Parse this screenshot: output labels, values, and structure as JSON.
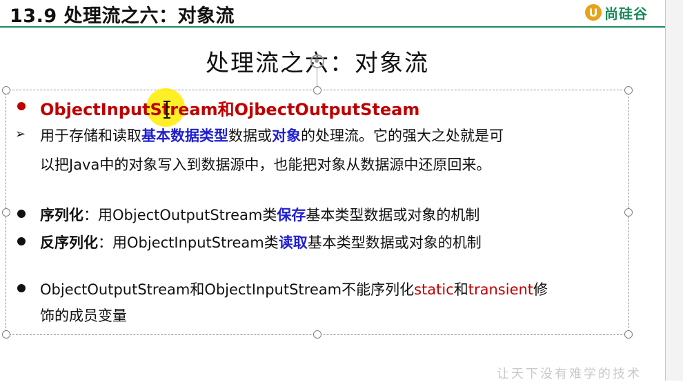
{
  "header": {
    "title": "13.9 处理流之六：对象流",
    "logo_mark": "U",
    "logo_text": "尚硅谷",
    "accent_color": "#1a8a5a"
  },
  "slide": {
    "title": "处理流之六：对象流",
    "heading": {
      "part1": "ObjectInputStream",
      "part2": "和",
      "part3": "OjbectOutputSteam",
      "color": "#c00000"
    },
    "description": {
      "line1_a": "用于存储和读取",
      "line1_b": "基本数据类型",
      "line1_c": "数据或",
      "line1_d": "对象",
      "line1_e": "的处理流。它的强大之处就是可",
      "line2": "以把Java中的对象写入到数据源中，也能把对象从数据源中还原回来。"
    },
    "serialization": {
      "label": "序列化",
      "text_a": "：用ObjectOutputStream类",
      "keyword": "保存",
      "text_b": "基本类型数据或对象的机制"
    },
    "deserialization": {
      "label": "反序列化",
      "text_a": "：用ObjectInputStream类",
      "keyword": "读取",
      "text_b": "基本类型数据或对象的机制"
    },
    "note": {
      "text_a": "ObjectOutputStream和ObjectInputStream不能序列化",
      "kw1": "static",
      "text_b": "和",
      "kw2": "transient",
      "text_c": "修",
      "line2": "饰的成员变量"
    }
  },
  "icons": {
    "bullet": "filled-circle",
    "sub_bullet": "arrow-right-icon",
    "rotate_handle": "rotate-icon",
    "cursor": "text-cursor-icon"
  },
  "watermark": "让天下没有难学的技术"
}
